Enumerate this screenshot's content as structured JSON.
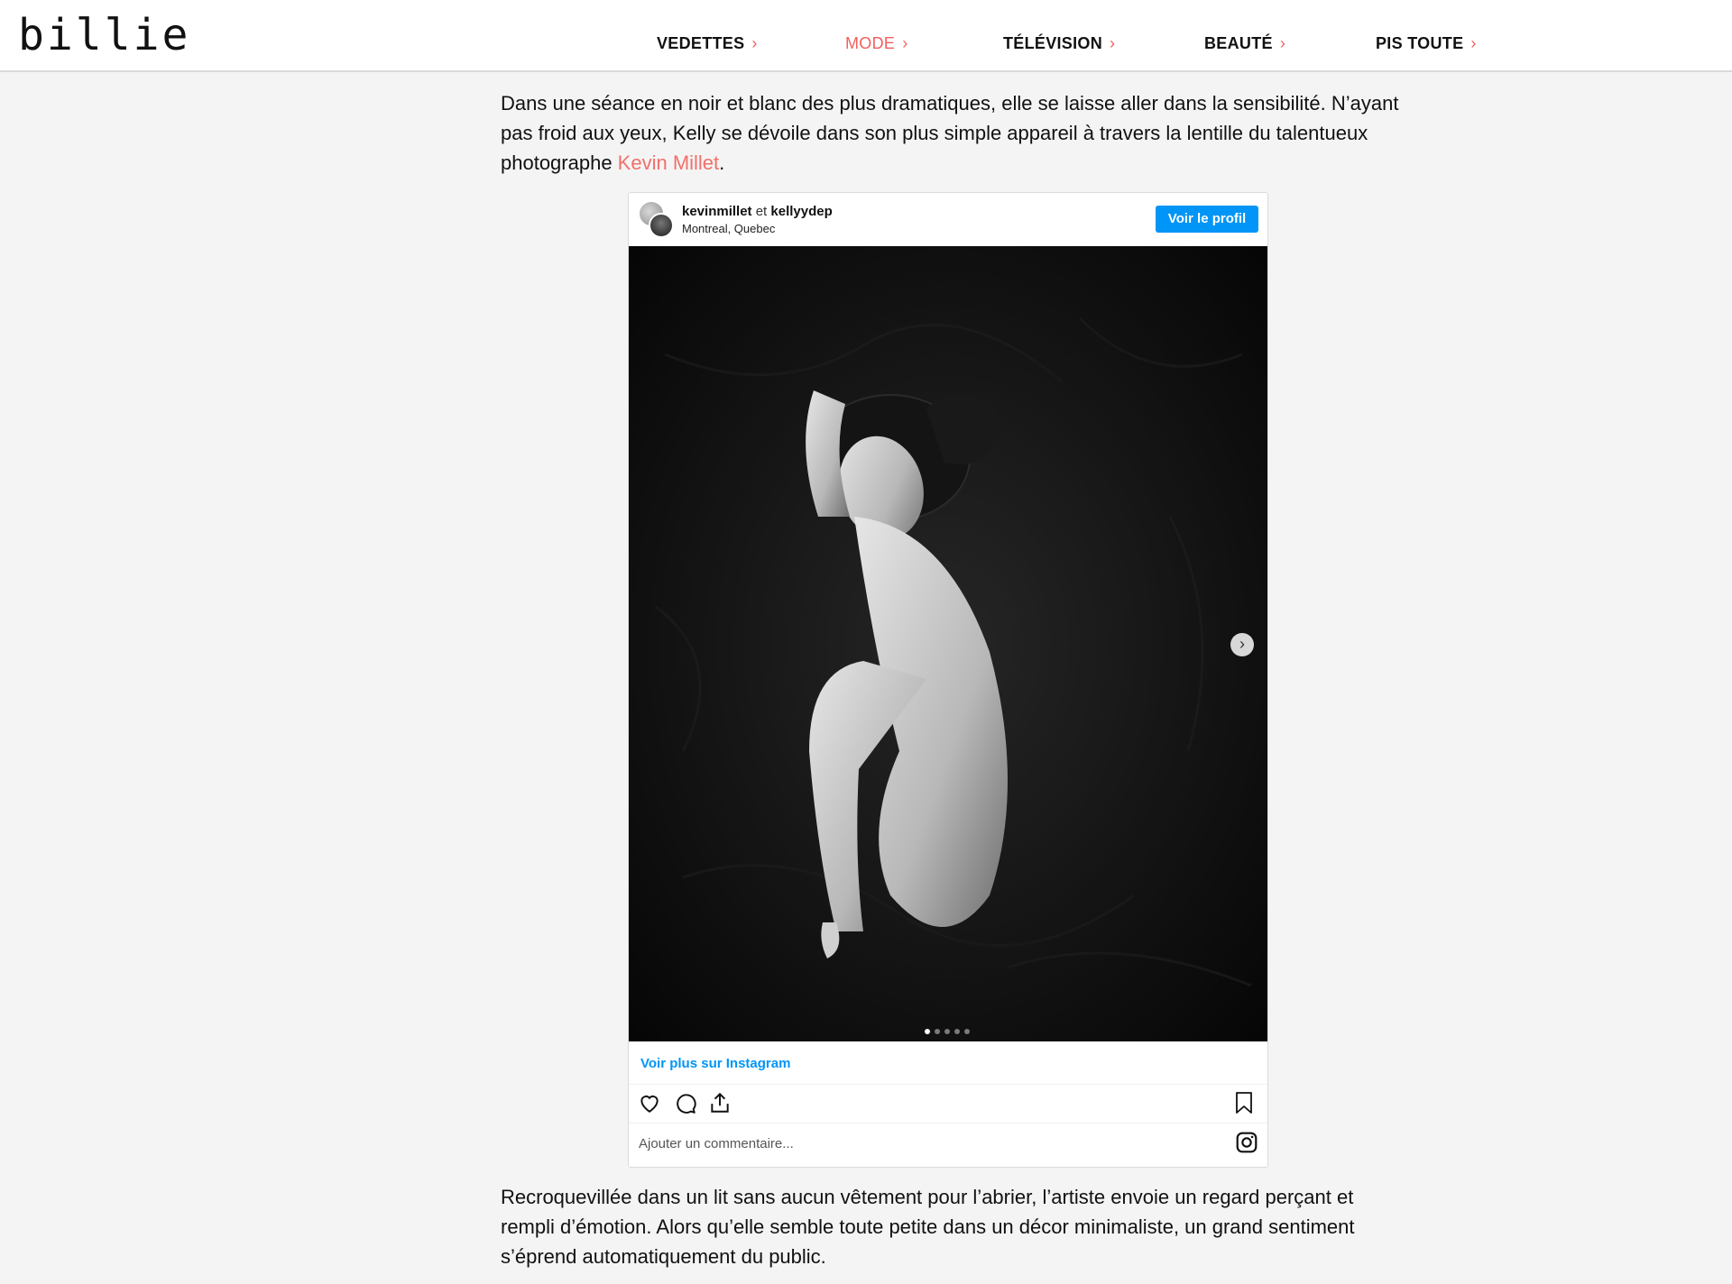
{
  "header": {
    "logo": "billie",
    "nav": [
      {
        "label": "VEDETTES",
        "active": false
      },
      {
        "label": "MODE",
        "active": true
      },
      {
        "label": "TÉLÉVISION",
        "active": false
      },
      {
        "label": "BEAUTÉ",
        "active": false
      },
      {
        "label": "PIS TOUTE",
        "active": false
      }
    ],
    "chevron": "›"
  },
  "article": {
    "para1_text": "Dans une séance en noir et blanc des plus dramatiques, elle se laisse aller dans la sensibilité. N’ayant pas froid aux yeux, Kelly se dévoile dans son plus simple appareil à travers la lentille du talentueux photographe ",
    "para1_link": "Kevin Millet",
    "para1_end": ".",
    "para2_text": "Recroquevillée dans un lit sans aucun vêtement pour l’abrier, l’artiste envoie un regard perçant et rempli d’émotion. Alors qu’elle semble toute petite dans un décor minimaliste, un grand sentiment s’éprend automatiquement du public."
  },
  "instagram": {
    "user1": "kevinmillet",
    "connector": "et",
    "user2": "kellyydep",
    "location": "Montreal, Quebec",
    "profile_button": "Voir le profil",
    "carousel_dots": 5,
    "carousel_active": 1,
    "next_icon": "chevron-right-icon",
    "more_link": "Voir plus sur Instagram",
    "comment_placeholder": "Ajouter un commentaire...",
    "icons": [
      "heart-icon",
      "comment-icon",
      "share-icon",
      "bookmark-icon",
      "instagram-icon"
    ]
  },
  "colors": {
    "accent": "#f15f5f",
    "link": "#f1706a",
    "instagram_blue": "#0095f6",
    "page_bg": "#f4f4f4"
  }
}
